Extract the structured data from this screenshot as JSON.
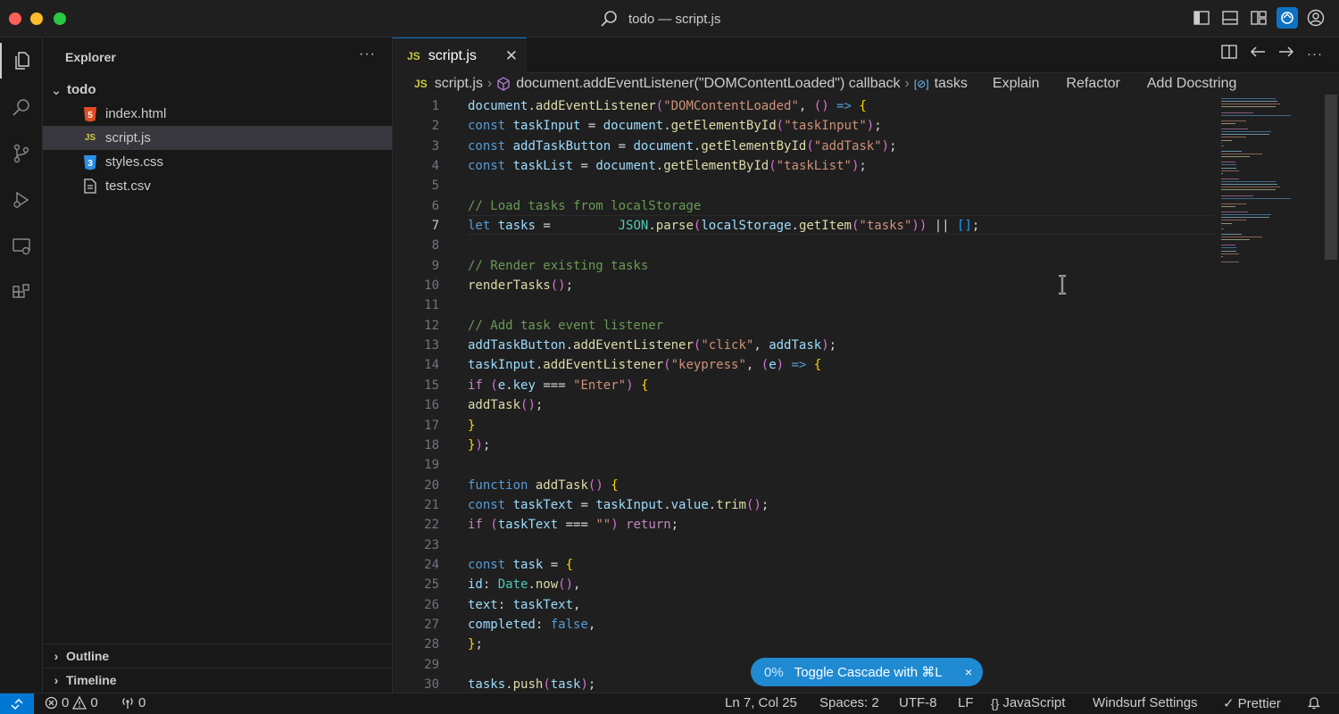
{
  "window": {
    "title": "todo — script.js"
  },
  "sidebar": {
    "header": "Explorer",
    "more": "···",
    "folder": "todo",
    "files": [
      {
        "name": "index.html",
        "icon": "html5-file-icon",
        "selected": false
      },
      {
        "name": "script.js",
        "icon": "js-file-icon",
        "selected": true
      },
      {
        "name": "styles.css",
        "icon": "css3-file-icon",
        "selected": false
      },
      {
        "name": "test.csv",
        "icon": "csv-file-icon",
        "selected": false
      }
    ],
    "outline_label": "Outline",
    "timeline_label": "Timeline"
  },
  "editor": {
    "tab": {
      "icon_text": "JS",
      "label": "script.js",
      "close": "✕"
    },
    "breadcrumbs": {
      "file": "script.js",
      "callback": "document.addEventListener(\"DOMContentLoaded\") callback",
      "symbol": "tasks",
      "actions": [
        "Explain",
        "Refactor",
        "Add Docstring"
      ]
    },
    "current_line": 7,
    "line_numbers": [
      "1",
      "2",
      "3",
      "4",
      "5",
      "6",
      "7",
      "8",
      "9",
      "10",
      "11",
      "12",
      "13",
      "14",
      "15",
      "16",
      "17",
      "18",
      "19",
      "20",
      "21",
      "22",
      "23",
      "24",
      "25",
      "26",
      "27",
      "28",
      "29",
      "30"
    ],
    "code_lines": [
      "document.addEventListener(\"DOMContentLoaded\", () => {",
      "const taskInput = document.getElementById(\"taskInput\");",
      "const addTaskButton = document.getElementById(\"addTask\");",
      "const taskList = document.getElementById(\"taskList\");",
      "",
      "// Load tasks from localStorage",
      "let tasks =         JSON.parse(localStorage.getItem(\"tasks\")) || [];",
      "",
      "// Render existing tasks",
      "renderTasks();",
      "",
      "// Add task event listener",
      "addTaskButton.addEventListener(\"click\", addTask);",
      "taskInput.addEventListener(\"keypress\", (e) => {",
      "if (e.key === \"Enter\") {",
      "addTask();",
      "}",
      "});",
      "",
      "function addTask() {",
      "const taskText = taskInput.value.trim();",
      "if (taskText === \"\") return;",
      "",
      "const task = {",
      "id: Date.now(),",
      "text: taskText,",
      "completed: false,",
      "};",
      "",
      "tasks.push(task);"
    ]
  },
  "cascade_toast": {
    "percent": "0%",
    "label": "Toggle Cascade with ⌘L",
    "close": "×"
  },
  "statusbar": {
    "errors": "0",
    "warnings": "0",
    "ports": "0",
    "position": "Ln 7, Col 25",
    "spaces": "Spaces: 2",
    "encoding": "UTF-8",
    "eol": "LF",
    "language": "JavaScript",
    "settings": "Windsurf Settings",
    "formatter": "Prettier"
  },
  "colors": {
    "accent": "#0078d4",
    "toast": "#1f8ad2",
    "background": "#1f1f1f"
  }
}
